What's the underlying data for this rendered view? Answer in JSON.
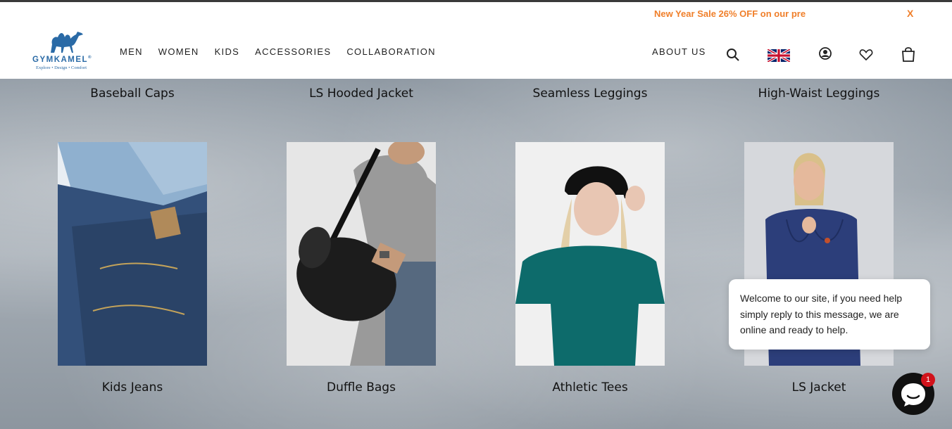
{
  "promo": {
    "text": "New Year Sale 26% OFF on our pre",
    "close_label": "X"
  },
  "logo": {
    "name": "GYMKAMEL",
    "registered": "®",
    "tagline": "Explore • Design • Comfort",
    "color": "#2a6aa6"
  },
  "nav": {
    "items": [
      {
        "label": "MEN"
      },
      {
        "label": "WOMEN"
      },
      {
        "label": "KIDS"
      },
      {
        "label": "ACCESSORIES"
      },
      {
        "label": "COLLABORATION"
      }
    ],
    "about_label": "ABOUT US"
  },
  "header_icons": [
    "search-icon",
    "uk-flag-icon",
    "account-icon",
    "wishlist-heart-icon",
    "cart-bag-icon"
  ],
  "top_row_titles": [
    "Baseball Caps",
    "LS Hooded Jacket",
    "Seamless Leggings",
    "High-Waist Leggings"
  ],
  "products": [
    {
      "title": "Kids Jeans"
    },
    {
      "title": "Duffle Bags"
    },
    {
      "title": "Athletic Tees"
    },
    {
      "title": "LS Jacket"
    }
  ],
  "chat": {
    "message": "Welcome to our site, if you need help simply reply to this message, we are online and ready to help.",
    "badge_count": "1"
  },
  "colors": {
    "accent_promo": "#f07f2a",
    "brand_blue": "#2a6aa6",
    "badge_red": "#d1121b"
  }
}
